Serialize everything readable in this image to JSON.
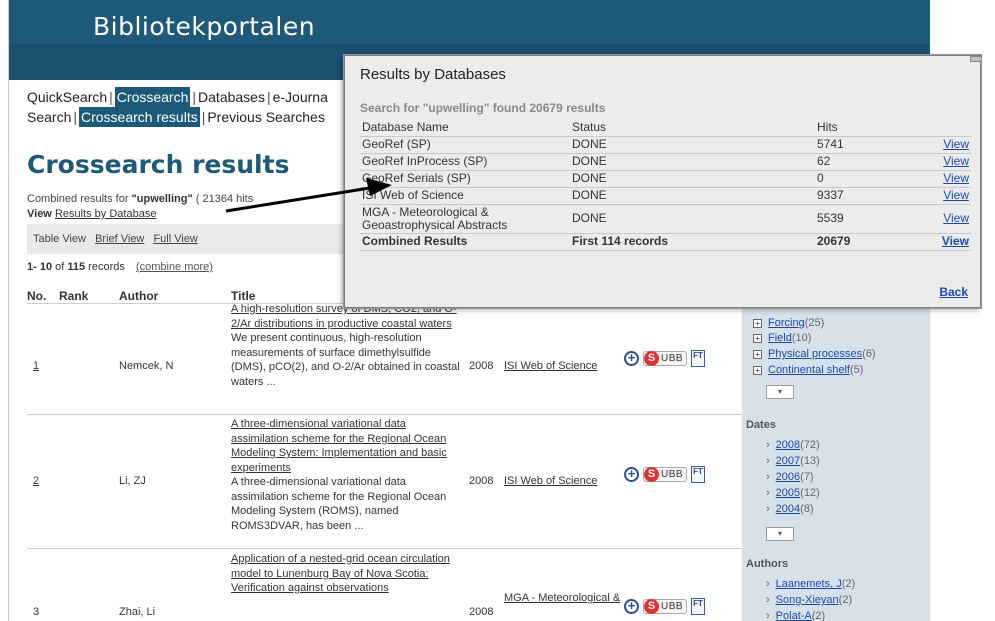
{
  "banner": {
    "title": "Bibliotekportalen"
  },
  "nav": {
    "row1": [
      "QuickSearch",
      "Crossearch",
      "Databases",
      "e-Journa"
    ],
    "row2": [
      "Search",
      "Crossearch results",
      "Previous Searches"
    ]
  },
  "page": {
    "heading": "Crossearch results",
    "combined_prefix": "Combined results for ",
    "combined_query": "\"upwelling\"",
    "combined_suffix": " ( 21364 hits",
    "view_prefix": "View ",
    "view_link": "Results by Database",
    "views": {
      "table": "Table View",
      "brief": "Brief View",
      "full": "Full View"
    },
    "records_range": "1- 10",
    "records_of": " of ",
    "records_total": "115",
    "records_suffix": " records",
    "combine_more": "(combine more)"
  },
  "columns": {
    "no": "No.",
    "rank": "Rank",
    "author": "Author",
    "title": "Title"
  },
  "results": [
    {
      "no": "1",
      "author": "Nemcek, N",
      "title": "A high-resolution survey of DMS, CO2, and O-2/Ar distributions in productive coastal waters",
      "abstract": "We present continuous, high-resolution measurements of surface dimethylsulfide (DMS), pCO(2), and O-2/Ar obtained in coastal waters ...",
      "year": "2008",
      "source": "ISI Web of Science"
    },
    {
      "no": "2",
      "author": "Li, ZJ",
      "title": "A three-dimensional variational data assimilation scheme for the Regional Ocean Modeling System: Implementation and basic experiments",
      "abstract": "A three-dimensional variational data assimilation scheme for the Regional Ocean Modeling System (ROMS), named ROMS3DVAR, has been ...",
      "year": "2008",
      "source": "ISI Web of Science"
    },
    {
      "no": "3",
      "author": "Zhai, Li",
      "title": "Application of a nested-grid ocean circulation model to Lunenburg Bay of Nova Scotia: Verification against observations",
      "abstract": "",
      "year": "2008",
      "source": "MGA - Meteorological &"
    }
  ],
  "icons": {
    "ubb_label": "UBB",
    "ft_label": "FT",
    "plus": "+",
    "s": "S"
  },
  "sidebar": {
    "topics": [
      {
        "label": "Forcing",
        "count": "(25)"
      },
      {
        "label": "Field",
        "count": "(10)"
      },
      {
        "label": "Physical processes",
        "count": "(6)"
      },
      {
        "label": "Continental shelf",
        "count": "(5)"
      }
    ],
    "dates_heading": "Dates",
    "dates": [
      {
        "label": "2008",
        "count": "(72)"
      },
      {
        "label": "2007",
        "count": "(13)"
      },
      {
        "label": "2006",
        "count": "(7)"
      },
      {
        "label": "2005",
        "count": "(12)"
      },
      {
        "label": "2004",
        "count": "(8)"
      }
    ],
    "authors_heading": "Authors",
    "authors": [
      {
        "label": "Laanemets, J",
        "count": "(2)"
      },
      {
        "label": "Song-Xieyan",
        "count": "(2)"
      },
      {
        "label": "Polat-A",
        "count": "(2)"
      }
    ]
  },
  "popup": {
    "title": "Results by Databases",
    "found": "Search for \"upwelling\" found 20679 results",
    "headers": {
      "name": "Database Name",
      "status": "Status",
      "hits": "Hits"
    },
    "rows": [
      {
        "name": "GeoRef (SP)",
        "status": "DONE",
        "hits": "5741",
        "view": "View"
      },
      {
        "name": "GeoRef InProcess (SP)",
        "status": "DONE",
        "hits": "62",
        "view": "View"
      },
      {
        "name": "GeoRef Serials (SP)",
        "status": "DONE",
        "hits": "0",
        "view": "View"
      },
      {
        "name": "ISI Web of Science",
        "status": "DONE",
        "hits": "9337",
        "view": "View"
      },
      {
        "name": "MGA - Meteorological & Geoastrophysical Abstracts",
        "status": "DONE",
        "hits": "5539",
        "view": "View"
      }
    ],
    "total": {
      "name": "Combined Results",
      "status": "First 114 records",
      "hits": "20679",
      "view": "View"
    },
    "back": "Back"
  }
}
